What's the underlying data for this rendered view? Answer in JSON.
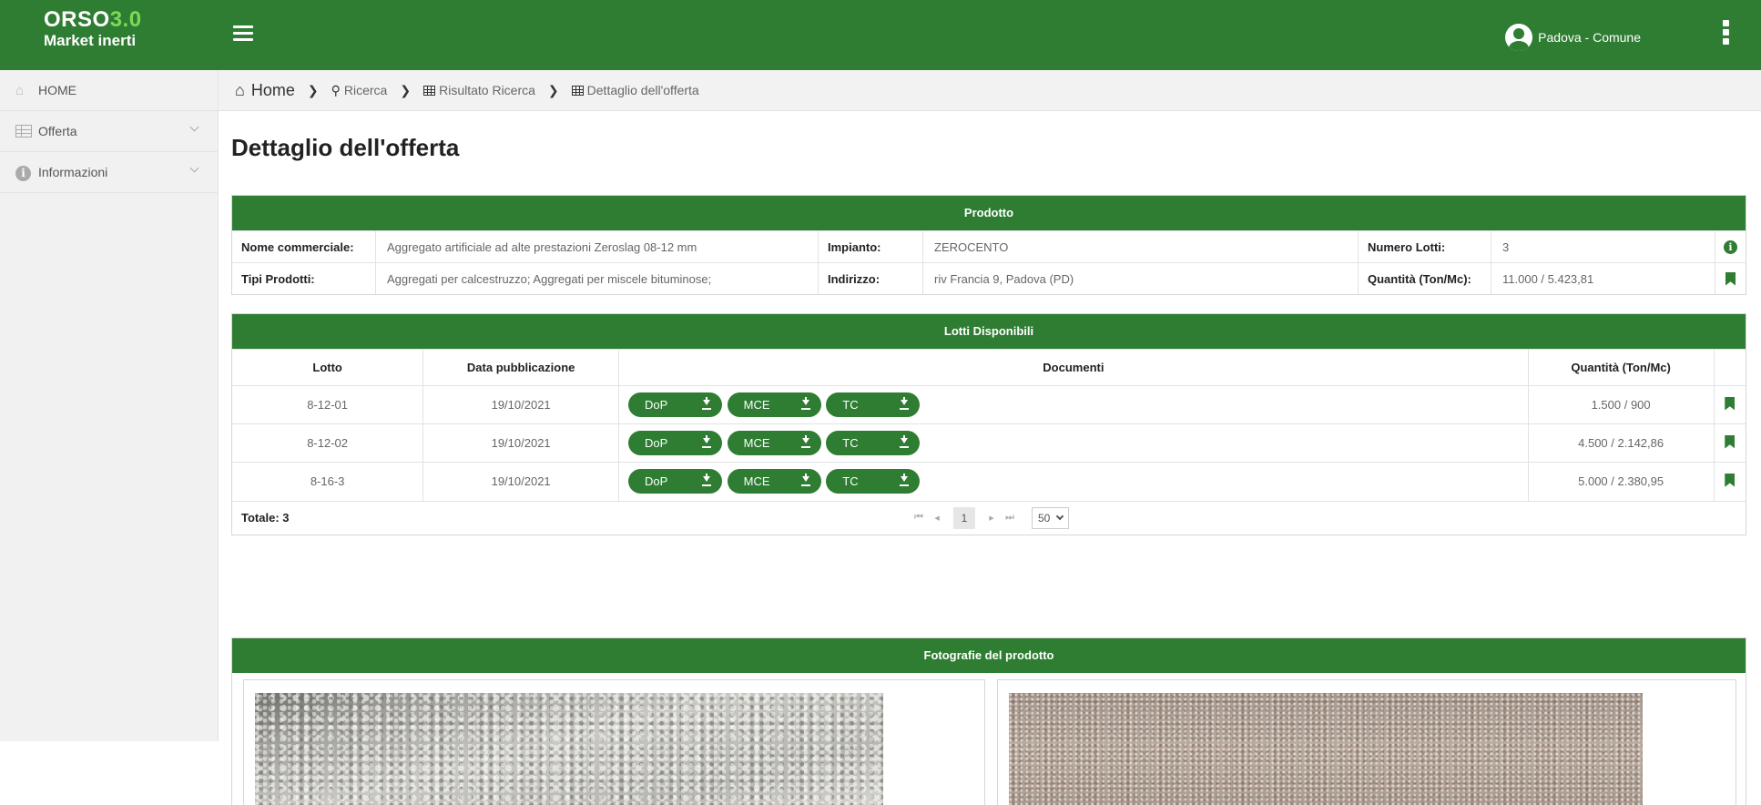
{
  "app": {
    "logo_main": "ORSO",
    "logo_version": "3.0",
    "logo_sub": "Market inerti",
    "user_label": "Padova - Comune"
  },
  "sidebar": {
    "items": [
      {
        "label": "HOME",
        "icon": "home-icon"
      },
      {
        "label": "Offerta",
        "icon": "table-icon"
      },
      {
        "label": "Informazioni",
        "icon": "info-icon"
      }
    ]
  },
  "breadcrumb": {
    "home": "Home",
    "ricerca": "Ricerca",
    "risultato": "Risultato Ricerca",
    "dettaglio": "Dettaglio dell'offerta"
  },
  "page_title": "Dettaglio dell'offerta",
  "prodotto": {
    "header": "Prodotto",
    "labels": {
      "nome": "Nome commerciale:",
      "tipi": "Tipi Prodotti:",
      "impianto": "Impianto:",
      "indirizzo": "Indirizzo:",
      "numero_lotti": "Numero Lotti:",
      "quantita": "Quantità (Ton/Mc):"
    },
    "values": {
      "nome": "Aggregato artificiale ad alte prestazioni Zeroslag 08-12 mm",
      "tipi": "Aggregati per calcestruzzo; Aggregati per miscele bituminose;",
      "impianto": "ZEROCENTO",
      "indirizzo": "riv Francia 9, Padova (PD)",
      "numero_lotti": "3",
      "quantita": "11.000 / 5.423,81"
    }
  },
  "lotti": {
    "header": "Lotti Disponibili",
    "columns": [
      "Lotto",
      "Data pubblicazione",
      "Documenti",
      "Quantità (Ton/Mc)"
    ],
    "doc_labels": [
      "DoP",
      "MCE",
      "TC"
    ],
    "rows": [
      {
        "lotto": "8-12-01",
        "data": "19/10/2021",
        "quantita": "1.500 / 900"
      },
      {
        "lotto": "8-12-02",
        "data": "19/10/2021",
        "quantita": "4.500 / 2.142,86"
      },
      {
        "lotto": "8-16-3",
        "data": "19/10/2021",
        "quantita": "5.000 / 2.380,95"
      }
    ],
    "totale": "Totale: 3",
    "pager": {
      "first": "⏮",
      "prev": "◂",
      "current": "1",
      "next": "▸",
      "last": "⏭",
      "page_size": "50"
    }
  },
  "foto": {
    "header": "Fotografie del prodotto"
  },
  "colors": {
    "brand_green": "#2e7d32",
    "logo_version": "#7ed957"
  }
}
